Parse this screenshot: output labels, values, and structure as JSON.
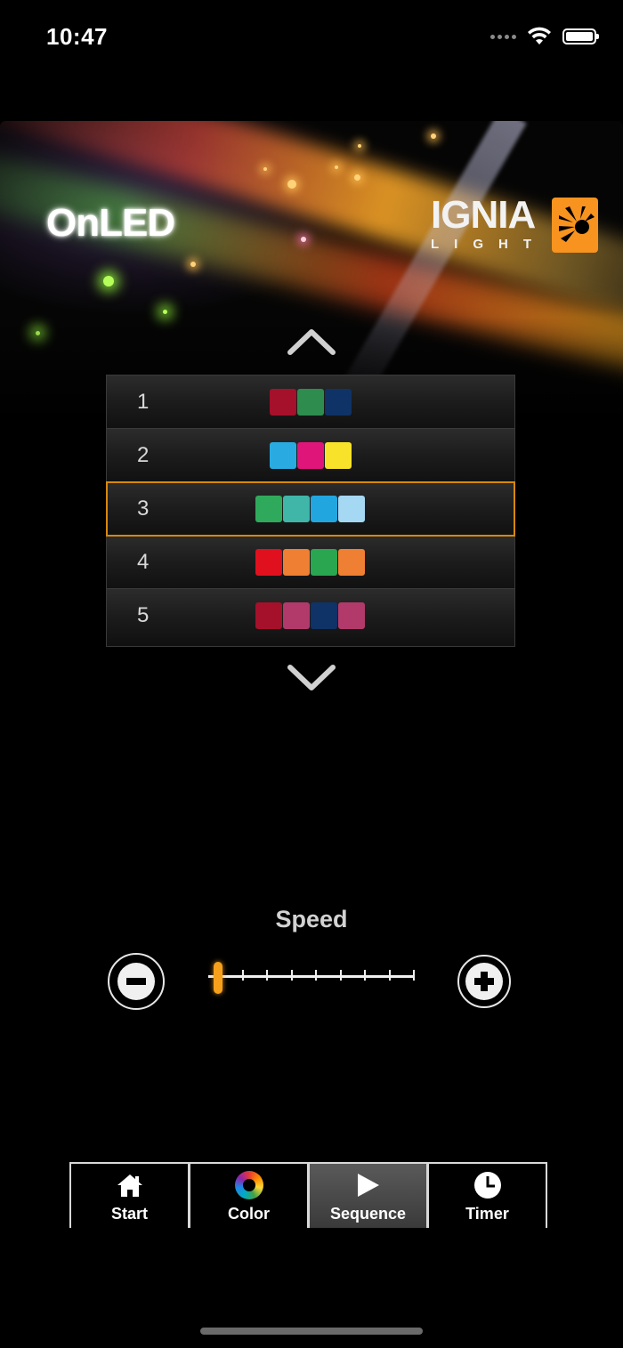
{
  "status_bar": {
    "time": "10:47"
  },
  "header": {
    "app_name": "OnLED",
    "brand_name": "IGNIA",
    "brand_sub": "LIGHT"
  },
  "sequences": [
    {
      "number": "1",
      "colors": [
        "#a5102b",
        "#2e8c4f",
        "#0f3366"
      ]
    },
    {
      "number": "2",
      "colors": [
        "#29abe2",
        "#e0157a",
        "#f8e32a"
      ]
    },
    {
      "number": "3",
      "colors": [
        "#2faa5c",
        "#3fb6a8",
        "#22a6e0",
        "#a5d8f3"
      ],
      "selected": true
    },
    {
      "number": "4",
      "colors": [
        "#e0101e",
        "#ef7f32",
        "#2aa650",
        "#ef7f32"
      ]
    },
    {
      "number": "5",
      "colors": [
        "#a5102b",
        "#b13a6b",
        "#0f3366",
        "#b13a6b"
      ]
    }
  ],
  "speed": {
    "label": "Speed",
    "level": 0,
    "steps": 8
  },
  "tabs": [
    {
      "label": "Start",
      "icon": "home-icon"
    },
    {
      "label": "Color",
      "icon": "color-wheel-icon"
    },
    {
      "label": "Sequence",
      "icon": "play-icon",
      "active": true
    },
    {
      "label": "Timer",
      "icon": "clock-icon"
    }
  ],
  "colors": {
    "accent": "#f7a01c",
    "selection_border": "#d7880d"
  }
}
